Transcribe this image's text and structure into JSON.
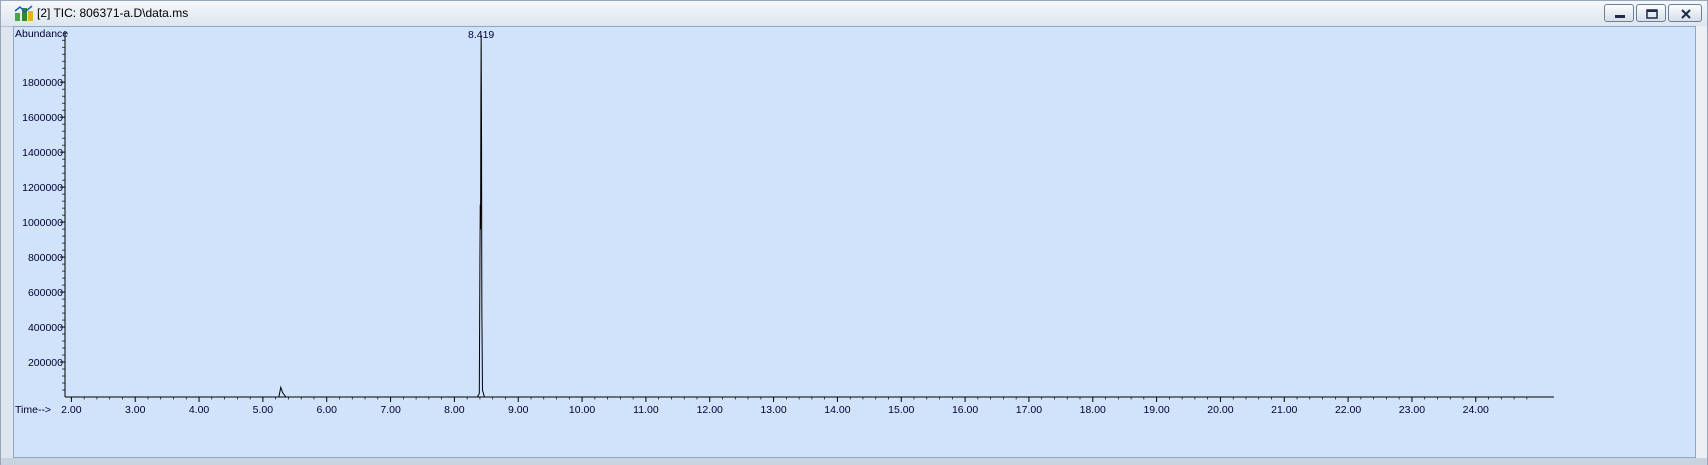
{
  "window": {
    "title": "[2] TIC: 806371-a.D\\data.ms",
    "app_icon": "chemstation-tic-icon",
    "controls": [
      "minimize-icon",
      "restore-icon",
      "close-icon"
    ]
  },
  "colors": {
    "plot_background": "#d1e2fb",
    "trace": "#000000",
    "axis_text": "#000033"
  },
  "chart_data": {
    "type": "line",
    "title": "",
    "xlabel": "Time-->",
    "ylabel": "Abundance",
    "xlim": [
      1.9,
      25.1
    ],
    "ylim": [
      0,
      2070000
    ],
    "x_ticks": [
      "2.00",
      "3.00",
      "4.00",
      "5.00",
      "6.00",
      "7.00",
      "8.00",
      "9.00",
      "10.00",
      "11.00",
      "12.00",
      "13.00",
      "14.00",
      "15.00",
      "16.00",
      "17.00",
      "18.00",
      "19.00",
      "20.00",
      "21.00",
      "22.00",
      "23.00",
      "24.00"
    ],
    "y_ticks": [
      "200000",
      "400000",
      "600000",
      "800000",
      "1000000",
      "1200000",
      "1400000",
      "1600000",
      "1800000"
    ],
    "grid": false,
    "series": [
      {
        "x": [
          1.9,
          5.25,
          5.28,
          5.31,
          5.36,
          8.36,
          8.39,
          8.4,
          8.405,
          8.41,
          8.415,
          8.419,
          8.425,
          8.43,
          8.44,
          8.47,
          25.1
        ],
        "y": [
          0,
          0,
          55000,
          25000,
          0,
          0,
          20000,
          800000,
          1100000,
          960000,
          1700000,
          2070000,
          1500000,
          500000,
          40000,
          0,
          0
        ]
      }
    ],
    "annotations": [
      {
        "x": 8.419,
        "label": "8.419"
      }
    ]
  }
}
